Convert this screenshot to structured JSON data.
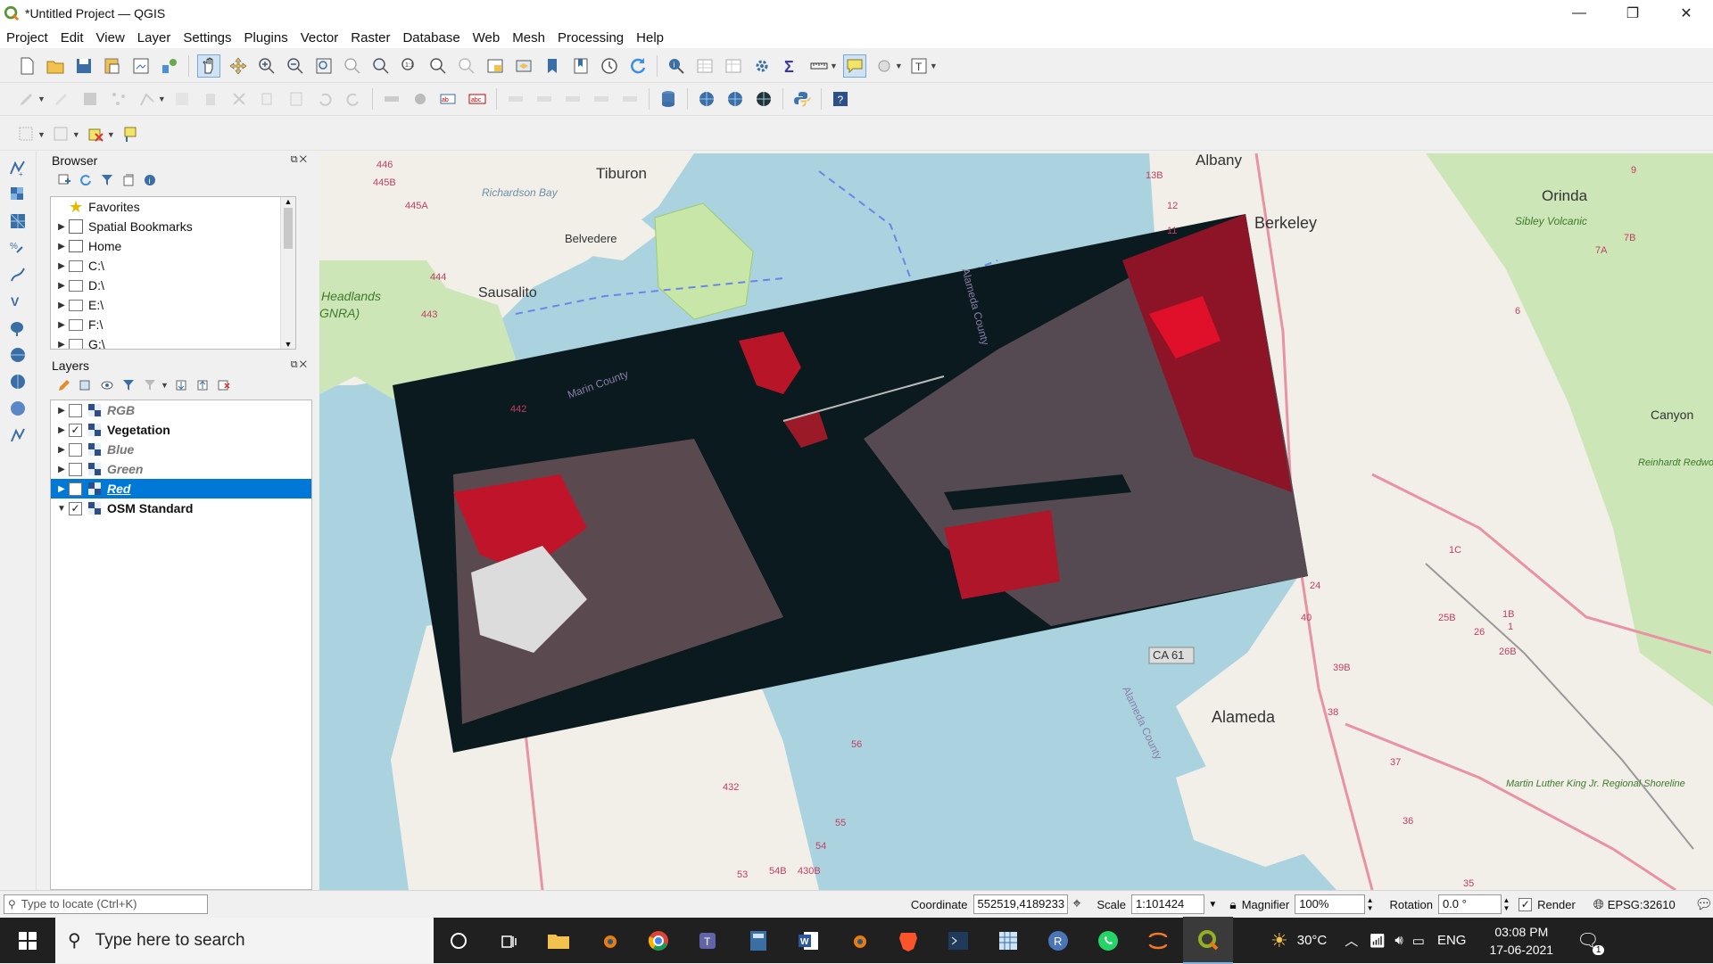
{
  "window": {
    "title": "*Untitled Project — QGIS",
    "controls": [
      "—",
      "❐",
      "✕"
    ]
  },
  "menu": [
    "Project",
    "Edit",
    "View",
    "Layer",
    "Settings",
    "Plugins",
    "Vector",
    "Raster",
    "Database",
    "Web",
    "Mesh",
    "Processing",
    "Help"
  ],
  "browser": {
    "title": "Browser",
    "items": [
      {
        "label": "Favorites",
        "icon": "star-icon"
      },
      {
        "label": "Spatial Bookmarks",
        "icon": "bookmark-icon"
      },
      {
        "label": "Home",
        "icon": "home-folder-icon"
      },
      {
        "label": "C:\\",
        "icon": "folder-icon"
      },
      {
        "label": "D:\\",
        "icon": "folder-icon"
      },
      {
        "label": "E:\\",
        "icon": "folder-icon"
      },
      {
        "label": "F:\\",
        "icon": "folder-icon"
      },
      {
        "label": "G:\\",
        "icon": "folder-icon"
      }
    ]
  },
  "layers": {
    "title": "Layers",
    "items": [
      {
        "label": "RGB",
        "checked": false,
        "style": "italic-gray"
      },
      {
        "label": "Vegetation",
        "checked": true,
        "style": "bold"
      },
      {
        "label": "Blue",
        "checked": false,
        "style": "italic-gray"
      },
      {
        "label": "Green",
        "checked": false,
        "style": "italic-gray"
      },
      {
        "label": "Red",
        "checked": false,
        "style": "selected"
      },
      {
        "label": "OSM Standard",
        "checked": true,
        "style": "bold"
      }
    ]
  },
  "map_labels": {
    "tiburon": "Tiburon",
    "albany": "Albany",
    "berkeley": "Berkeley",
    "orinda": "Orinda",
    "belvedere": "Belvedere",
    "sausalito": "Sausalito",
    "headlands": "Headlands",
    "gnra": "GNRA)",
    "richardson_bay": "Richardson Bay",
    "marin_county": "Marin County",
    "alameda_county": "Alameda County",
    "alameda": "Alameda",
    "canyon": "Canyon",
    "sibley": "Sibley Volcanic",
    "reinhardt": "Reinhardt Redwood Regional Park",
    "martin_luther": "Martin Luther King Jr. Regional Shoreline",
    "ca61": "CA 61",
    "r446": "446",
    "r445b": "445B",
    "r445a": "445A",
    "r444": "444",
    "r443": "443",
    "r442": "442",
    "r13b": "13B",
    "r12": "12",
    "r11": "11",
    "r9": "9",
    "r7a": "7A",
    "r7b": "7B",
    "r6": "6",
    "r432": "432",
    "r56": "56",
    "r55": "55",
    "r54": "54",
    "r53": "53",
    "r54b": "54B",
    "r430b": "430B",
    "r39b": "39B",
    "r40": "40",
    "r38": "38",
    "r37": "37",
    "r36": "36",
    "r35": "35",
    "r24": "24",
    "r25b": "25B",
    "r26": "26",
    "r26b": "26B",
    "r1c": "1C",
    "r1b": "1B",
    "r1": "1"
  },
  "status": {
    "locate_placeholder": "Type to locate (Ctrl+K)",
    "coordinate_label": "Coordinate",
    "coordinate_value": "552519,4189233",
    "scale_label": "Scale",
    "scale_value": "1:101424",
    "magnifier_label": "Magnifier",
    "magnifier_value": "100%",
    "rotation_label": "Rotation",
    "rotation_value": "0.0 °",
    "render_label": "Render",
    "crs": "EPSG:32610"
  },
  "taskbar": {
    "search_placeholder": "Type here to search",
    "temperature": "30°C",
    "language": "ENG",
    "time": "03:08 PM",
    "date": "17-06-2021",
    "notifications": "1"
  }
}
